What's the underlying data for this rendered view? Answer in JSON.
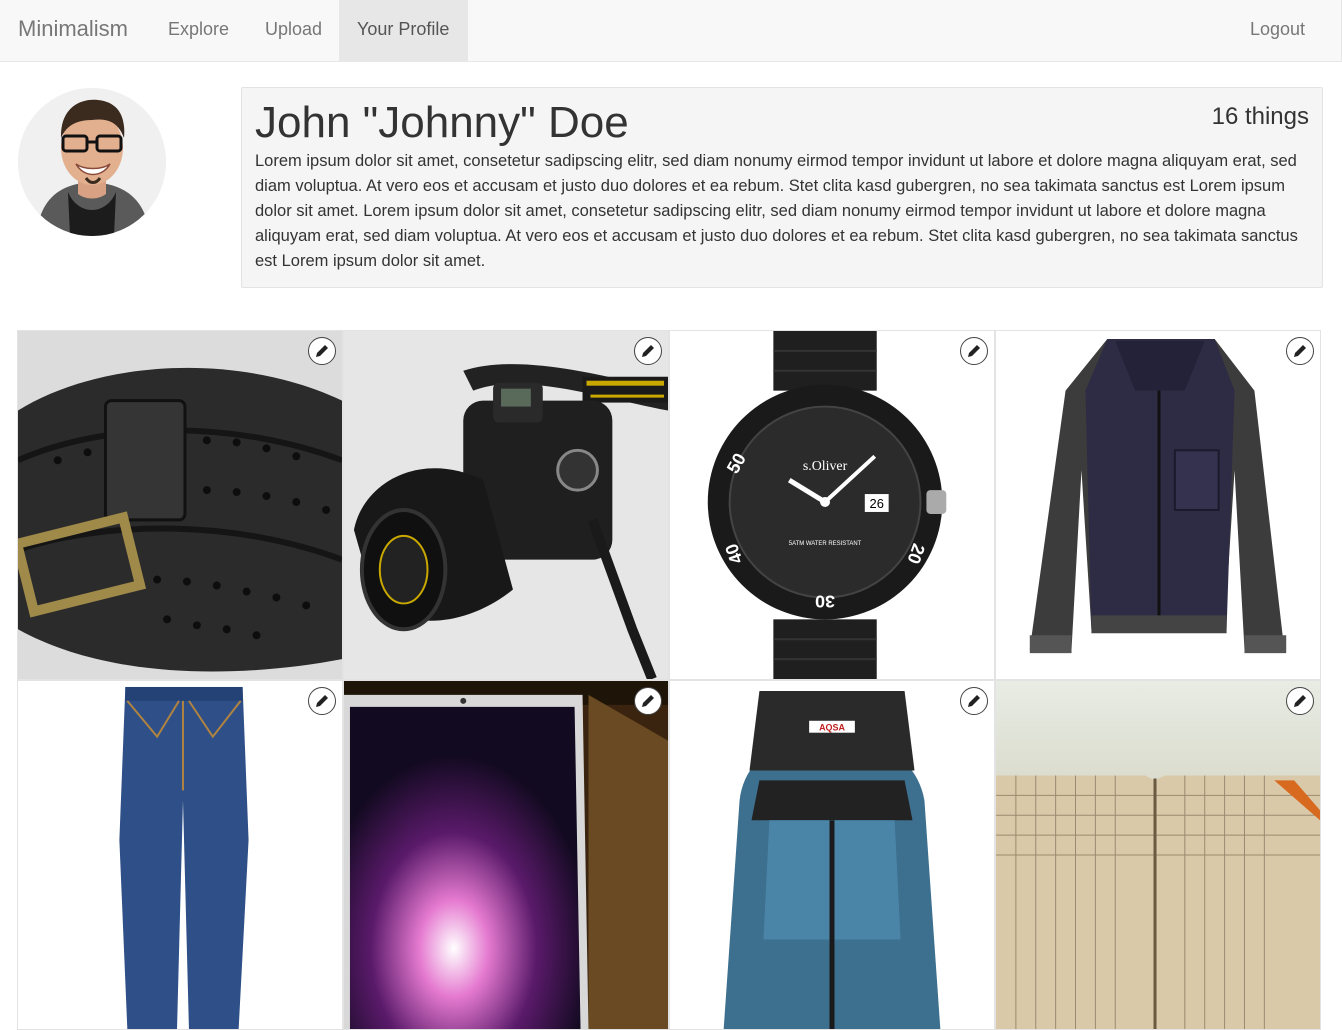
{
  "nav": {
    "brand": "Minimalism",
    "items": [
      {
        "label": "Explore"
      },
      {
        "label": "Upload"
      },
      {
        "label": "Your Profile",
        "active": true
      }
    ],
    "logout": "Logout"
  },
  "profile": {
    "name": "John \"Johnny\" Doe",
    "thing_count": "16 things",
    "bio": "Lorem ipsum dolor sit amet, consetetur sadipscing elitr, sed diam nonumy eirmod tempor invidunt ut labore et dolore magna aliquyam erat, sed diam voluptua. At vero eos et accusam et justo duo dolores et ea rebum. Stet clita kasd gubergren, no sea takimata sanctus est Lorem ipsum dolor sit amet. Lorem ipsum dolor sit amet, consetetur sadipscing elitr, sed diam nonumy eirmod tempor invidunt ut labore et dolore magna aliquyam erat, sed diam voluptua. At vero eos et accusam et justo duo dolores et ea rebum. Stet clita kasd gubergren, no sea takimata sanctus est Lorem ipsum dolor sit amet."
  },
  "things": [
    {
      "item": "belt",
      "edit_icon": "pencil-icon"
    },
    {
      "item": "camera",
      "edit_icon": "pencil-icon"
    },
    {
      "item": "watch",
      "edit_icon": "pencil-icon",
      "watch_brand": "s.Oliver",
      "watch_date": "26",
      "watch_text": "5ATM WATER RESISTANT",
      "bezel_numbers": [
        "50",
        "40",
        "30",
        "20"
      ]
    },
    {
      "item": "jacket",
      "edit_icon": "pencil-icon"
    },
    {
      "item": "jeans",
      "edit_icon": "pencil-icon"
    },
    {
      "item": "laptop",
      "edit_icon": "pencil-icon"
    },
    {
      "item": "backpack",
      "edit_icon": "pencil-icon",
      "bag_label": "AQSA"
    },
    {
      "item": "notebook",
      "edit_icon": "pencil-icon"
    }
  ],
  "colors": {
    "navbar_bg": "#f8f8f8",
    "active_nav_bg": "#e7e7e7",
    "bio_bg": "#f5f5f5"
  }
}
